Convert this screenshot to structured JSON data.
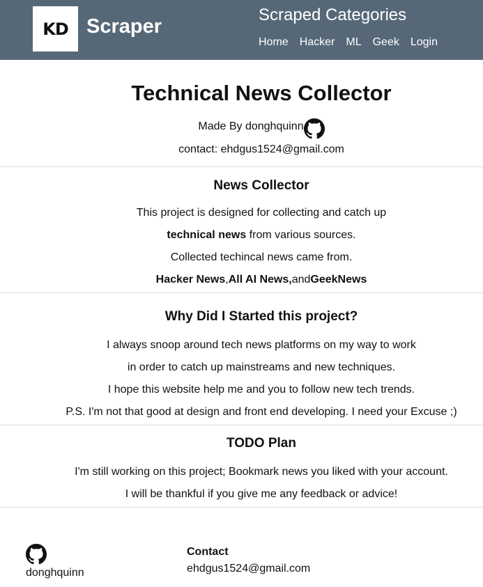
{
  "header": {
    "logo_text": "KD",
    "brand": "Scraper",
    "nav_title": "Scraped Categories",
    "nav": [
      "Home",
      "Hacker",
      "ML",
      "Geek",
      "Login"
    ]
  },
  "hero": {
    "title": "Technical News Collector",
    "made_by": "Made By donghquinn",
    "contact": "contact: ehdgus1524@gmail.com"
  },
  "news_collector": {
    "title": "News Collector",
    "line1": "This project is designed for collecting and catch up",
    "line2_bold": "technical news",
    "line2_rest": " from various sources.",
    "line3": "Collected techincal news came from.",
    "src1": "Hacker News",
    "sep1": ",",
    "src2": "All AI News,",
    "sep2": "and",
    "src3": "GeekNews"
  },
  "why": {
    "title": "Why Did I Started this project?",
    "lines": [
      "I always snoop around tech news platforms on my way to work",
      "in order to catch up mainstreams and new techniques.",
      "I hope this website help me and you to follow new tech trends.",
      "P.S. I'm not that good at design and front end developing. I need your Excuse ;)"
    ]
  },
  "todo": {
    "title": "TODO Plan",
    "lines": [
      "I'm still working on this project; Bookmark news you liked with your account.",
      "I will be thankful if you give me any feedback or advice!"
    ]
  },
  "footer": {
    "name": "donghquinn",
    "contact_heading": "Contact",
    "email": "ehdgus1524@gmail.com"
  },
  "icons": {
    "github": "github-icon"
  }
}
